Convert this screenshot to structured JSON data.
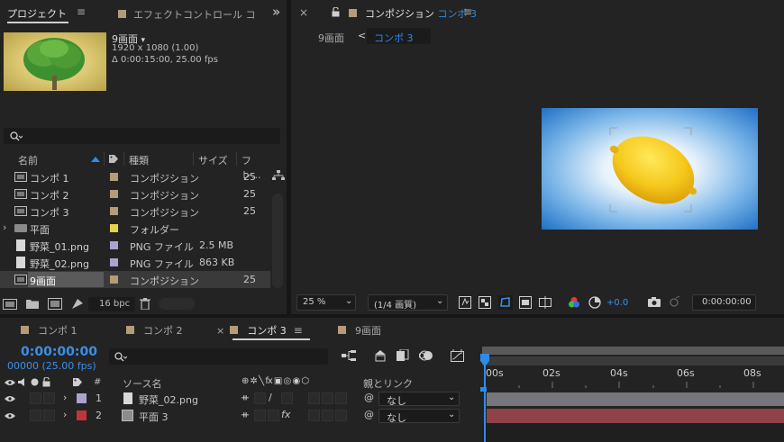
{
  "project_panel": {
    "tab_project": "プロジェクト",
    "tab_effects": "エフェクトコントロール コ",
    "expand_icon": "»",
    "selected_item": {
      "name": "9画面",
      "name_arrow": "▾",
      "dimensions": "1920 x 1080 (1.00)",
      "duration": "Δ 0:00:15:00, 25.00 fps"
    },
    "search_placeholder": "",
    "columns": {
      "name": "名前",
      "type": "種類",
      "size": "サイズ",
      "fps": "フレ..."
    },
    "items": [
      {
        "name": "コンポ 1",
        "type": "コンポジション",
        "size": "",
        "fps": "25",
        "label_color": "#b59b78",
        "icon": "composition-icon"
      },
      {
        "name": "コンポ 2",
        "type": "コンポジション",
        "size": "",
        "fps": "25",
        "label_color": "#b59b78",
        "icon": "composition-icon"
      },
      {
        "name": "コンポ 3",
        "type": "コンポジション",
        "size": "",
        "fps": "25",
        "label_color": "#b59b78",
        "icon": "composition-icon"
      },
      {
        "name": "平面",
        "type": "フォルダー",
        "size": "",
        "fps": "",
        "label_color": "#e6d24a",
        "icon": "folder-icon"
      },
      {
        "name": "野菜_01.png",
        "type": "PNG ファイル",
        "size": "2.5 MB",
        "fps": "",
        "label_color": "#a8a3cf",
        "icon": "file-icon"
      },
      {
        "name": "野菜_02.png",
        "type": "PNG ファイル",
        "size": "863 KB",
        "fps": "",
        "label_color": "#a8a3cf",
        "icon": "file-icon"
      },
      {
        "name": "9画面",
        "type": "コンポジション",
        "size": "",
        "fps": "25",
        "label_color": "#b59b78",
        "icon": "composition-icon",
        "selected": true
      }
    ],
    "bpc_label": "16 bpc"
  },
  "composition_panel": {
    "close_x": "×",
    "lock_icon": "lock-icon",
    "title_prefix": "コンポジション",
    "title_comp": "コンポ 3",
    "menu_icon": "≡",
    "breadcrumb_parent": "9画面",
    "breadcrumb_sep": "<",
    "breadcrumb_current": "コンポ 3",
    "zoom_value": "25 %",
    "resolution_value": "(1/4 画質)",
    "exposure_value": "+0.0",
    "timecode": "0:00:00:00"
  },
  "timeline": {
    "tabs": [
      {
        "label": "コンポ 1",
        "active": false
      },
      {
        "label": "コンポ 2",
        "active": false
      },
      {
        "label": "コンポ 3",
        "active": true
      },
      {
        "label": "9画面",
        "active": false
      }
    ],
    "tab_close": "×",
    "tab_menu": "≡",
    "current_time": "0:00:00:00",
    "current_frames": "00000 (25.00 fps)",
    "ruler_labels": [
      "00s",
      "02s",
      "04s",
      "06s",
      "08s"
    ],
    "headers": {
      "index": "#",
      "source_name": "ソース名",
      "parent": "親とリンク",
      "switches": "⊕ ✲ ╲ fx ▣ ◎ ◉ ⬡"
    },
    "layers": [
      {
        "index": "1",
        "name": "野菜_02.png",
        "label_color": "#a8a3cf",
        "parent": "なし",
        "fx": "",
        "bar_color": "#77767c"
      },
      {
        "index": "2",
        "name": "平面 3",
        "label_color": "#c0353a",
        "parent": "なし",
        "fx": "fx",
        "bar_color": "#8d4347"
      }
    ]
  },
  "colors": {
    "accent_blue": "#2d8ceb",
    "timecode_blue": "#3d8fe8",
    "panel_bg": "#232323"
  }
}
